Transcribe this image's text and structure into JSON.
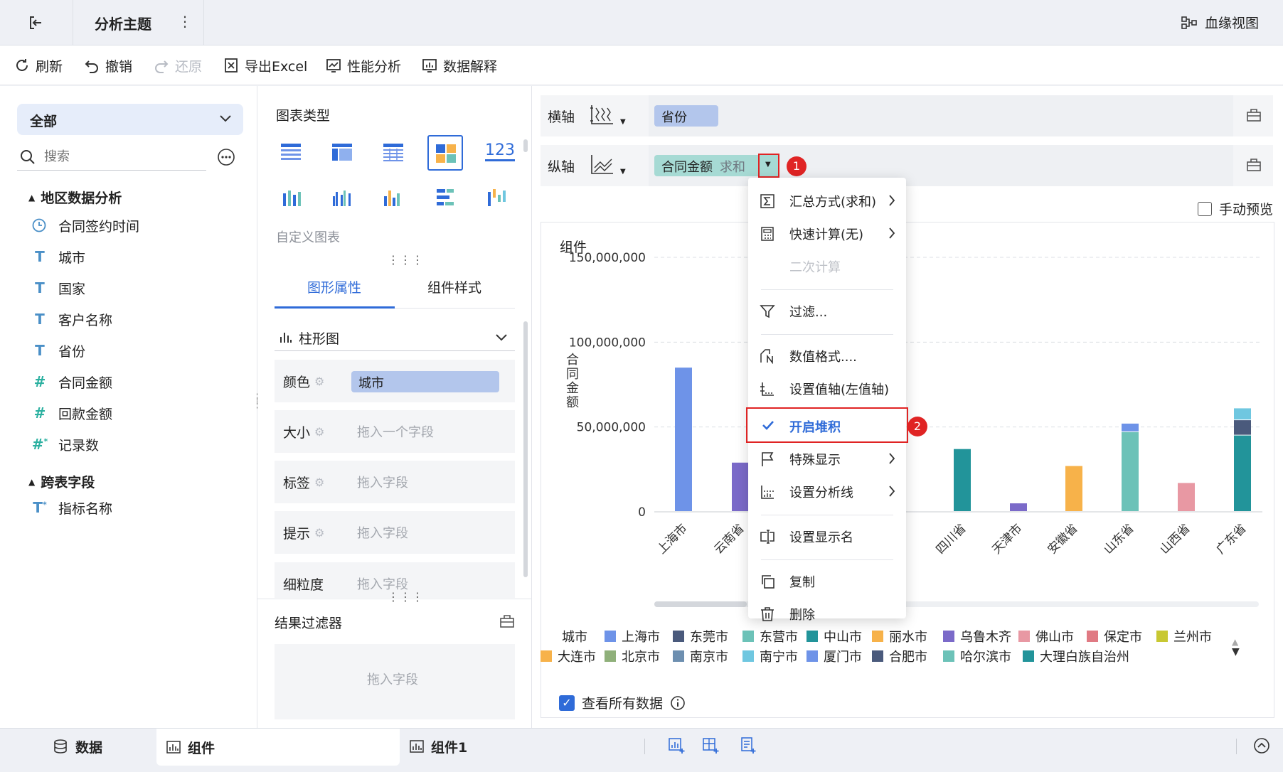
{
  "header": {
    "title": "分析主题",
    "lineage_label": "血缘视图"
  },
  "toolbar": {
    "refresh": "刷新",
    "undo": "撤销",
    "redo": "还原",
    "export_excel": "导出Excel",
    "performance": "性能分析",
    "data_explain": "数据解释"
  },
  "left": {
    "scope_selected": "全部",
    "search_placeholder": "搜索",
    "group1_title": "地区数据分析",
    "fields": [
      {
        "icon": "clock",
        "label": "合同签约时间"
      },
      {
        "icon": "T",
        "label": "城市"
      },
      {
        "icon": "T",
        "label": "国家"
      },
      {
        "icon": "T",
        "label": "客户名称"
      },
      {
        "icon": "T",
        "label": "省份"
      },
      {
        "icon": "#",
        "label": "合同金额"
      },
      {
        "icon": "#",
        "label": "回款金额"
      },
      {
        "icon": "#*",
        "label": "记录数"
      }
    ],
    "group2_title": "跨表字段",
    "group2_fields": [
      {
        "icon": "T*",
        "label": "指标名称"
      }
    ]
  },
  "mid": {
    "chart_type_title": "图表类型",
    "custom_chart": "自定义图表",
    "tab_graph": "图形属性",
    "tab_style": "组件样式",
    "chart_kind": "柱形图",
    "props": [
      {
        "label": "颜色",
        "value": "城市"
      },
      {
        "label": "大小",
        "value": "拖入一个字段"
      },
      {
        "label": "标签",
        "value": "拖入字段"
      },
      {
        "label": "提示",
        "value": "拖入字段"
      },
      {
        "label": "细粒度",
        "value": "拖入字段"
      }
    ],
    "result_filter": "结果过滤器",
    "filter_drop": "拖入字段"
  },
  "right": {
    "x_axis_label": "横轴",
    "x_field": "省份",
    "y_axis_label": "纵轴",
    "y_field": "合同金额",
    "y_agg": "求和",
    "manual_preview": "手动预览",
    "component_title": "组件",
    "view_all_data": "查看所有数据",
    "badge1": "1",
    "badge2": "2"
  },
  "menu": {
    "items": [
      {
        "icon": "sigma",
        "label": "汇总方式(求和)",
        "arrow": true,
        "disabled": false
      },
      {
        "icon": "calc",
        "label": "快速计算(无)",
        "arrow": true,
        "disabled": false
      },
      {
        "icon": "",
        "label": "二次计算",
        "arrow": false,
        "disabled": true
      },
      {
        "icon": "filter",
        "label": "过滤...",
        "arrow": false,
        "disabled": false
      },
      {
        "icon": "numfmt",
        "label": "数值格式....",
        "arrow": false,
        "disabled": false
      },
      {
        "icon": "axis",
        "label": "设置值轴(左值轴)",
        "arrow": false,
        "disabled": false
      },
      {
        "icon": "check",
        "label": "开启堆积",
        "arrow": false,
        "disabled": false,
        "highlighted": true
      },
      {
        "icon": "flag",
        "label": "特殊显示",
        "arrow": true,
        "disabled": false
      },
      {
        "icon": "line",
        "label": "设置分析线",
        "arrow": true,
        "disabled": false
      },
      {
        "icon": "rename",
        "label": "设置显示名",
        "arrow": false,
        "disabled": false
      },
      {
        "icon": "copy",
        "label": "复制",
        "arrow": false,
        "disabled": false
      },
      {
        "icon": "trash",
        "label": "删除",
        "arrow": false,
        "disabled": false
      }
    ]
  },
  "chart_data": {
    "type": "bar",
    "stacked": true,
    "ylabel": "合同金额",
    "ylim": [
      0,
      150000000
    ],
    "yticks": [
      "0",
      "50,000,000",
      "100,000,000",
      "150,000,000"
    ],
    "grid": true,
    "categories": [
      "上海市",
      "云南省",
      "四川省",
      "天津市",
      "安徽省",
      "山东省",
      "山西省",
      "广东省"
    ],
    "series": [
      {
        "name": "上海市",
        "color": "#6e93e8",
        "values": [
          85000000,
          0,
          0,
          0,
          0,
          0,
          0,
          0
        ]
      },
      {
        "name": "乌鲁木齐",
        "color": "#7b6ac9",
        "values": [
          0,
          29000000,
          0,
          5000000,
          0,
          0,
          0,
          0
        ]
      },
      {
        "name": "大理白族自治州",
        "color": "#22949a",
        "values": [
          0,
          0,
          37000000,
          0,
          0,
          0,
          0,
          45000000
        ]
      },
      {
        "name": "大连市",
        "color": "#f7b24a",
        "values": [
          0,
          0,
          0,
          0,
          27000000,
          0,
          0,
          0
        ]
      },
      {
        "name": "哈尔滨市",
        "color": "#6cc2b8",
        "values": [
          0,
          0,
          0,
          0,
          0,
          47000000,
          0,
          0
        ]
      },
      {
        "name": "厦门市",
        "color": "#6e93e8",
        "values": [
          0,
          0,
          0,
          0,
          0,
          5000000,
          0,
          0
        ]
      },
      {
        "name": "佛山市",
        "color": "#e898a3",
        "values": [
          0,
          0,
          0,
          0,
          0,
          0,
          17000000,
          0
        ]
      },
      {
        "name": "合肥市",
        "color": "#4a5a7c",
        "values": [
          0,
          0,
          0,
          0,
          0,
          0,
          0,
          9000000
        ]
      },
      {
        "name": "南宁市",
        "color": "#6fc7e0",
        "values": [
          0,
          0,
          0,
          0,
          0,
          0,
          0,
          7000000
        ]
      }
    ],
    "legend_title": "城市",
    "legend": [
      {
        "name": "上海市",
        "color": "#6e93e8"
      },
      {
        "name": "东莞市",
        "color": "#4a5a7c"
      },
      {
        "name": "东营市",
        "color": "#6cc2b8"
      },
      {
        "name": "中山市",
        "color": "#22949a"
      },
      {
        "name": "丽水市",
        "color": "#f7b24a"
      },
      {
        "name": "乌鲁木齐",
        "color": "#7b6ac9"
      },
      {
        "name": "佛山市",
        "color": "#e898a3"
      },
      {
        "name": "保定市",
        "color": "#e07a83"
      },
      {
        "name": "兰州市",
        "color": "#c8c832"
      },
      {
        "name": "北京市",
        "color": "#8fb07a"
      },
      {
        "name": "南京市",
        "color": "#6d8fb0"
      },
      {
        "name": "南宁市",
        "color": "#6fc7e0"
      },
      {
        "name": "厦门市",
        "color": "#6e93e8"
      },
      {
        "name": "合肥市",
        "color": "#4a5a7c"
      },
      {
        "name": "哈尔滨市",
        "color": "#6cc2b8"
      },
      {
        "name": "大理白族自治州",
        "color": "#22949a"
      },
      {
        "name": "大连市",
        "color": "#f7b24a"
      }
    ]
  },
  "bottom": {
    "data_tab": "数据",
    "tab1": "组件",
    "tab2": "组件1"
  },
  "colors": {
    "accent": "#2f6bd8",
    "highlight_border": "#e02424",
    "pill_blue": "#b3c6ec",
    "pill_teal": "#a6dad4"
  }
}
